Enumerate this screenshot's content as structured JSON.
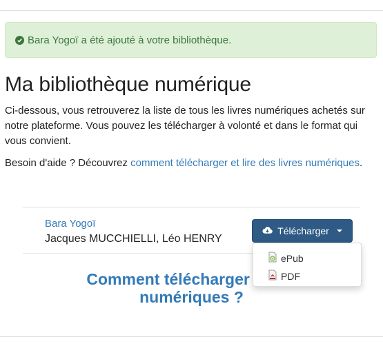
{
  "alert": {
    "message": "Bara Yogoï a été ajouté à votre bibliothèque.",
    "color": "#3c763d",
    "background": "#dff0d8"
  },
  "page": {
    "title": "Ma bibliothèque numérique",
    "intro": "Ci-dessous, vous retrouverez la liste de tous les livres numériques achetés sur notre plateforme. Vous pouvez les télécharger à volonté et dans le format qui vous convient.",
    "help_prefix": "Besoin d'aide ? Découvrez ",
    "help_link": "comment télécharger et lire des livres numériques",
    "help_suffix": "."
  },
  "book": {
    "title": "Bara Yogoï",
    "authors": "Jacques MUCCHIELLI, Léo HENRY"
  },
  "download_button": {
    "label": "Télécharger",
    "icon": "cloud-download-icon",
    "color": "#2e5a85"
  },
  "download_menu": [
    {
      "label": "ePub",
      "icon": "epub-file-icon"
    },
    {
      "label": "PDF",
      "icon": "pdf-file-icon"
    }
  ],
  "faq": {
    "line1": "Comment télécharger et lire",
    "line2": "numériques ?"
  },
  "link_color": "#337ab7"
}
